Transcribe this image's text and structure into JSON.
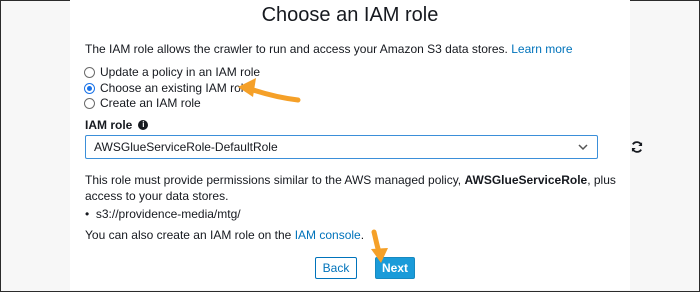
{
  "title": "Choose an IAM role",
  "intro": {
    "text": "The IAM role allows the crawler to run and access your Amazon S3 data stores.",
    "link": "Learn more"
  },
  "options": [
    {
      "label": "Update a policy in an IAM role",
      "checked": false
    },
    {
      "label": "Choose an existing IAM role",
      "checked": true
    },
    {
      "label": "Create an IAM role",
      "checked": false
    }
  ],
  "iam_role": {
    "label": "IAM role",
    "selected": "AWSGlueServiceRole-DefaultRole"
  },
  "description": {
    "before": "This role must provide permissions similar to the AWS managed policy, ",
    "bold": "AWSGlueServiceRole",
    "after": ", plus access to your data stores."
  },
  "data_store": "s3://providence-media/mtg/",
  "console_line": {
    "text": "You can also create an IAM role on the ",
    "link": "IAM console",
    "end": "."
  },
  "buttons": {
    "back": "Back",
    "next": "Next"
  },
  "icons": {
    "info": "info-icon",
    "chevron": "chevron-down-icon",
    "refresh": "refresh-icon"
  },
  "colors": {
    "link": "#0073bb",
    "primary_button": "#1a9bd9",
    "annotation_arrow": "#f5a028"
  }
}
